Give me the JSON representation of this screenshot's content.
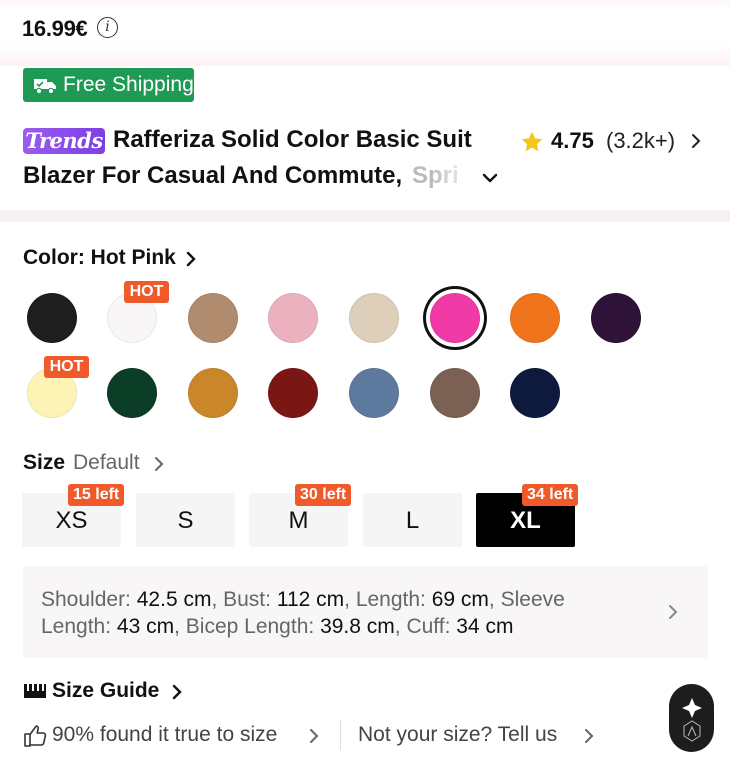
{
  "price": {
    "value": "16.99€",
    "info_icon": "info-icon"
  },
  "shipping": {
    "label": "Free Shipping",
    "icon": "truck-icon",
    "color": "#1f9a55"
  },
  "product": {
    "badge": "Trends",
    "title_line1": "Rafferiza Solid Color Basic Suit",
    "title_line2": "Blazer For Casual And Commute,",
    "title_overflow": "Spri",
    "rating": "4.75",
    "review_count": "(3.2k+)"
  },
  "color": {
    "label": "Color: Hot Pink",
    "selected": "Hot Pink",
    "swatches": [
      {
        "hex": "#1e1e1e",
        "tag": ""
      },
      {
        "hex": "#f8f6f6",
        "tag": "HOT"
      },
      {
        "hex": "#b08b6e",
        "tag": ""
      },
      {
        "hex": "#ebb1bf",
        "tag": ""
      },
      {
        "hex": "#ddcfba",
        "tag": ""
      },
      {
        "hex": "#f03ba7",
        "tag": "",
        "selected": true
      },
      {
        "hex": "#f0741c",
        "tag": ""
      },
      {
        "hex": "#2e1238",
        "tag": ""
      },
      {
        "hex": "#fdf3b5",
        "tag": "HOT"
      },
      {
        "hex": "#0c3d27",
        "tag": ""
      },
      {
        "hex": "#c9862a",
        "tag": ""
      },
      {
        "hex": "#7a1714",
        "tag": ""
      },
      {
        "hex": "#5d7a9e",
        "tag": ""
      },
      {
        "hex": "#7a6153",
        "tag": ""
      },
      {
        "hex": "#0d1a3e",
        "tag": ""
      }
    ]
  },
  "size": {
    "label": "Size",
    "default_label": "Default",
    "options": [
      {
        "label": "XS",
        "stock": "15 left"
      },
      {
        "label": "S",
        "stock": ""
      },
      {
        "label": "M",
        "stock": "30 left"
      },
      {
        "label": "L",
        "stock": ""
      },
      {
        "label": "XL",
        "stock": "34 left",
        "selected": true
      }
    ]
  },
  "measurements": {
    "shoulder_label": "Shoulder:",
    "shoulder": "42.5 cm",
    "bust_label": "Bust:",
    "bust": "112 cm",
    "length_label": "Length:",
    "length": "69 cm",
    "sleeve_label": "Sleeve Length:",
    "sleeve": "43 cm",
    "bicep_label": "Bicep Length:",
    "bicep": "39.8 cm",
    "cuff_label": "Cuff:",
    "cuff": "34 cm"
  },
  "size_guide": {
    "label": "Size Guide"
  },
  "fit": {
    "true_to_size": "90% found it true to size",
    "not_your_size": "Not your size? Tell us"
  },
  "colors": {
    "accent_tag": "#f05a2a",
    "trends": "#8b4ef0",
    "star": "#f7c51a"
  }
}
